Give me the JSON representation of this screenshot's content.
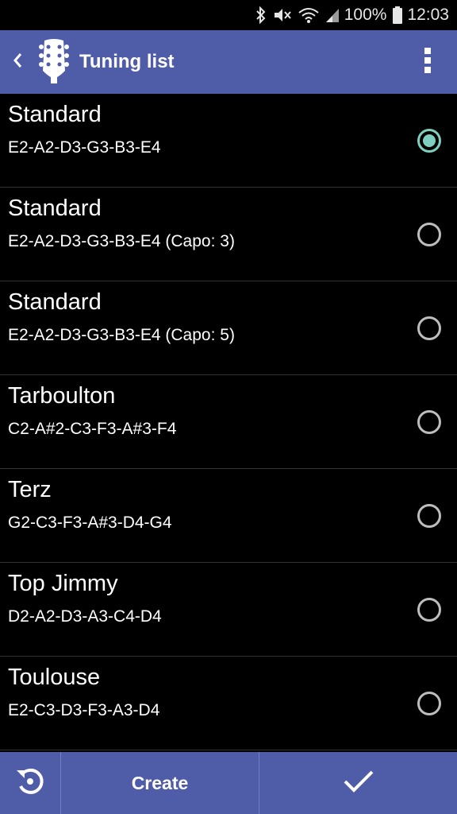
{
  "status_bar": {
    "battery_percent": "100%",
    "time": "12:03",
    "icons": [
      "bluetooth-icon",
      "mute-icon",
      "wifi-icon",
      "signal-icon",
      "battery-icon"
    ]
  },
  "app_bar": {
    "title": "Tuning list",
    "back_icon": "chevron-left-icon",
    "logo_icon": "guitar-headstock-icon",
    "menu_icon": "more-vertical-icon",
    "color": "#4f5ca7"
  },
  "tunings": [
    {
      "name": "Standard",
      "notes": "E2-A2-D3-G3-B3-E4",
      "selected": true
    },
    {
      "name": "Standard",
      "notes": "E2-A2-D3-G3-B3-E4 (Capo: 3)",
      "selected": false
    },
    {
      "name": "Standard",
      "notes": "E2-A2-D3-G3-B3-E4 (Capo: 5)",
      "selected": false
    },
    {
      "name": "Tarboulton",
      "notes": "C2-A#2-C3-F3-A#3-F4",
      "selected": false
    },
    {
      "name": "Terz",
      "notes": "G2-C3-F3-A#3-D4-G4",
      "selected": false
    },
    {
      "name": "Top Jimmy",
      "notes": "D2-A2-D3-A3-C4-D4",
      "selected": false
    },
    {
      "name": "Toulouse",
      "notes": "E2-C3-D3-F3-A3-D4",
      "selected": false
    }
  ],
  "bottom_bar": {
    "reset_icon": "reset-icon",
    "create_label": "Create",
    "confirm_icon": "checkmark-icon"
  },
  "colors": {
    "accent": "#7fcfc0",
    "bar": "#4f5ca7",
    "background": "#000000"
  }
}
